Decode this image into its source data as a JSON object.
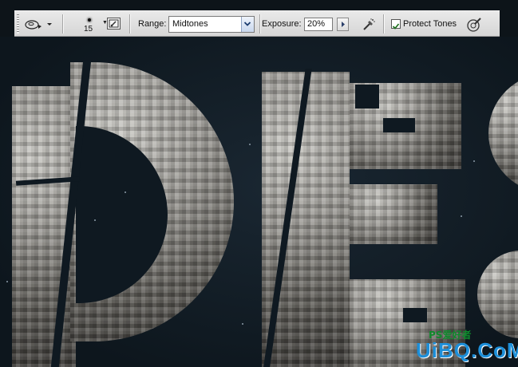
{
  "toolbar": {
    "tool_preset_icon": "sponge-tool-icon",
    "brush_size": "15",
    "range_label": "Range:",
    "range_value": "Midtones",
    "exposure_label": "Exposure:",
    "exposure_value": "20%",
    "airbrush_icon": "airbrush-icon",
    "protect_tones_label": "Protect Tones",
    "protect_tones_checked": true,
    "pressure_icon": "pressure-size-icon"
  },
  "canvas": {
    "image_subject": "stone-textured letters",
    "letters": [
      "D",
      "E",
      "S"
    ]
  },
  "watermark": {
    "small_text": "PS爱好者",
    "big_text": "UiBQ.CoM"
  },
  "colors": {
    "toolbar_bg": "#dcdcdc",
    "canvas_bg": "#0f1820",
    "watermark_green": "#0f8a2c",
    "watermark_blue": "#1d8fd9"
  }
}
